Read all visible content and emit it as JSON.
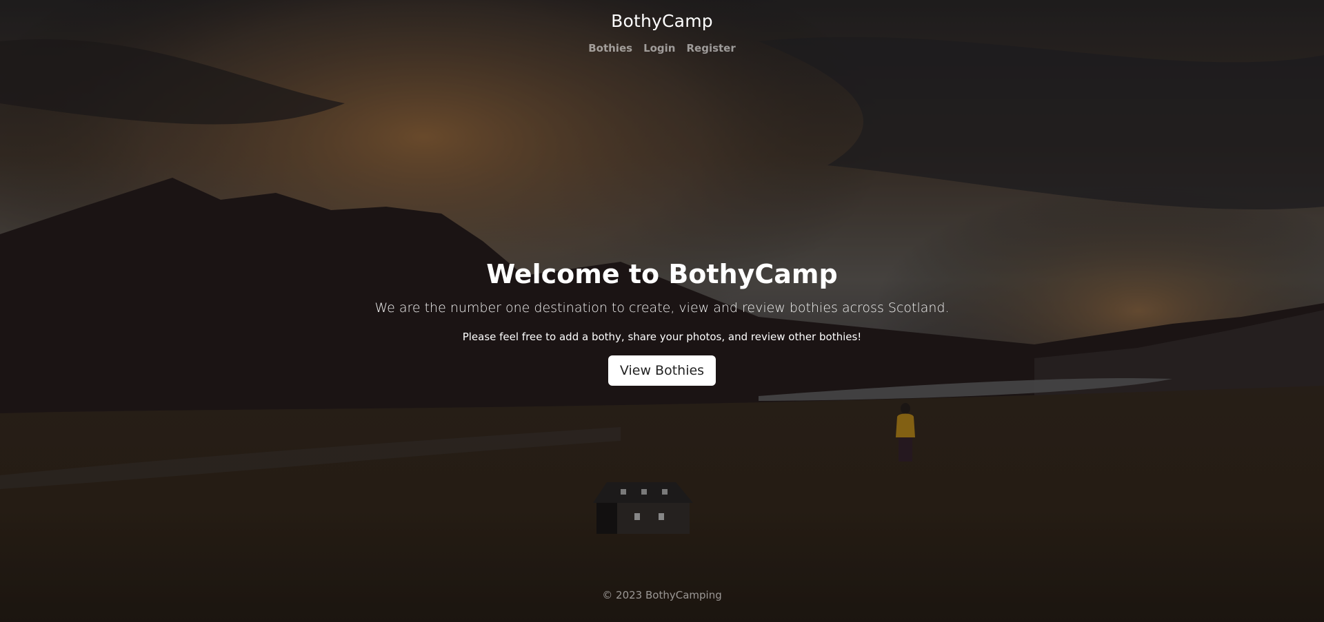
{
  "header": {
    "brand": "BothyCamp",
    "nav": [
      {
        "label": "Bothies"
      },
      {
        "label": "Login"
      },
      {
        "label": "Register"
      }
    ]
  },
  "hero": {
    "title": "Welcome to BothyCamp",
    "lead": "We are the number one destination to create, view and review bothies across Scotland.",
    "sub": "Please feel free to add a bothy, share your photos, and review other bothies!",
    "cta_label": "View Bothies"
  },
  "footer": {
    "text": "© 2023 BothyCamping"
  },
  "colors": {
    "overlay": "#000000",
    "button_bg": "#ffffff",
    "nav_text": "#8c8c8c"
  },
  "icons": []
}
